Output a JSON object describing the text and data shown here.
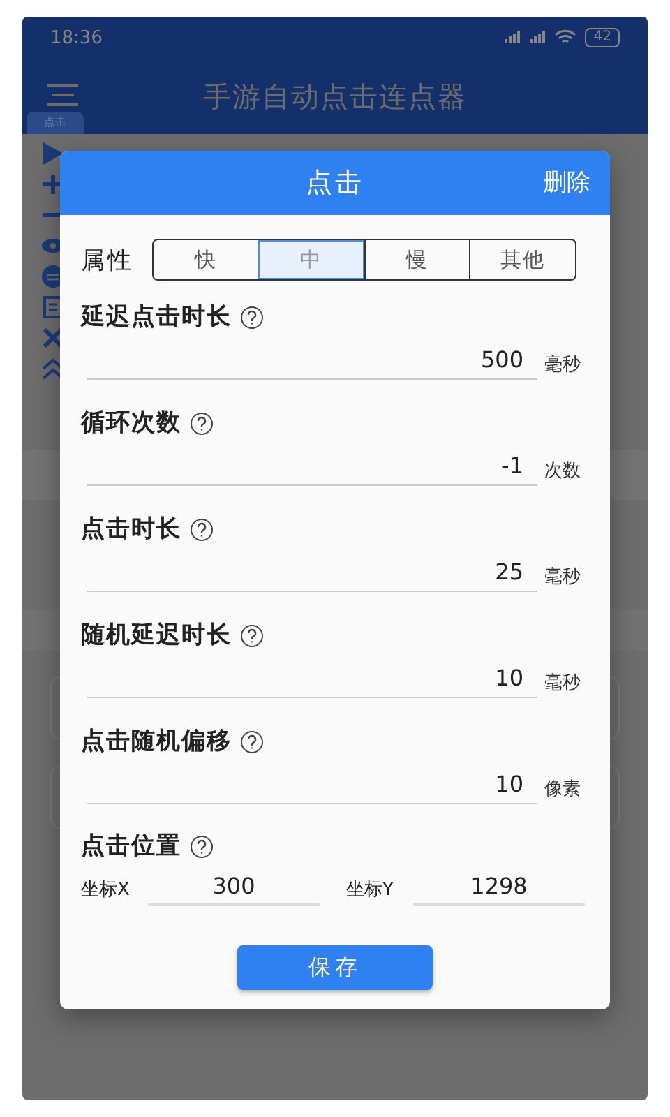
{
  "status_bar": {
    "time": "18:36",
    "battery": "42"
  },
  "app_bar": {
    "title": "手游自动点击连点器",
    "tab_label": "点击"
  },
  "dialog": {
    "title": "点击",
    "action": "删除",
    "property_label": "属性",
    "speed_options": [
      {
        "label": "快",
        "selected": false
      },
      {
        "label": "中",
        "selected": true
      },
      {
        "label": "慢",
        "selected": false
      },
      {
        "label": "其他",
        "selected": false
      }
    ],
    "fields": [
      {
        "label": "延迟点击时长",
        "value": "500",
        "unit": "毫秒"
      },
      {
        "label": "循环次数",
        "value": "-1",
        "unit": "次数"
      },
      {
        "label": "点击时长",
        "value": "25",
        "unit": "毫秒"
      },
      {
        "label": "随机延迟时长",
        "value": "10",
        "unit": "毫秒"
      },
      {
        "label": "点击随机偏移",
        "value": "10",
        "unit": "像素"
      }
    ],
    "position": {
      "label": "点击位置",
      "x_label": "坐标X",
      "x_value": "300",
      "y_label": "坐标Y",
      "y_value": "1298"
    },
    "save_button": "保存"
  }
}
